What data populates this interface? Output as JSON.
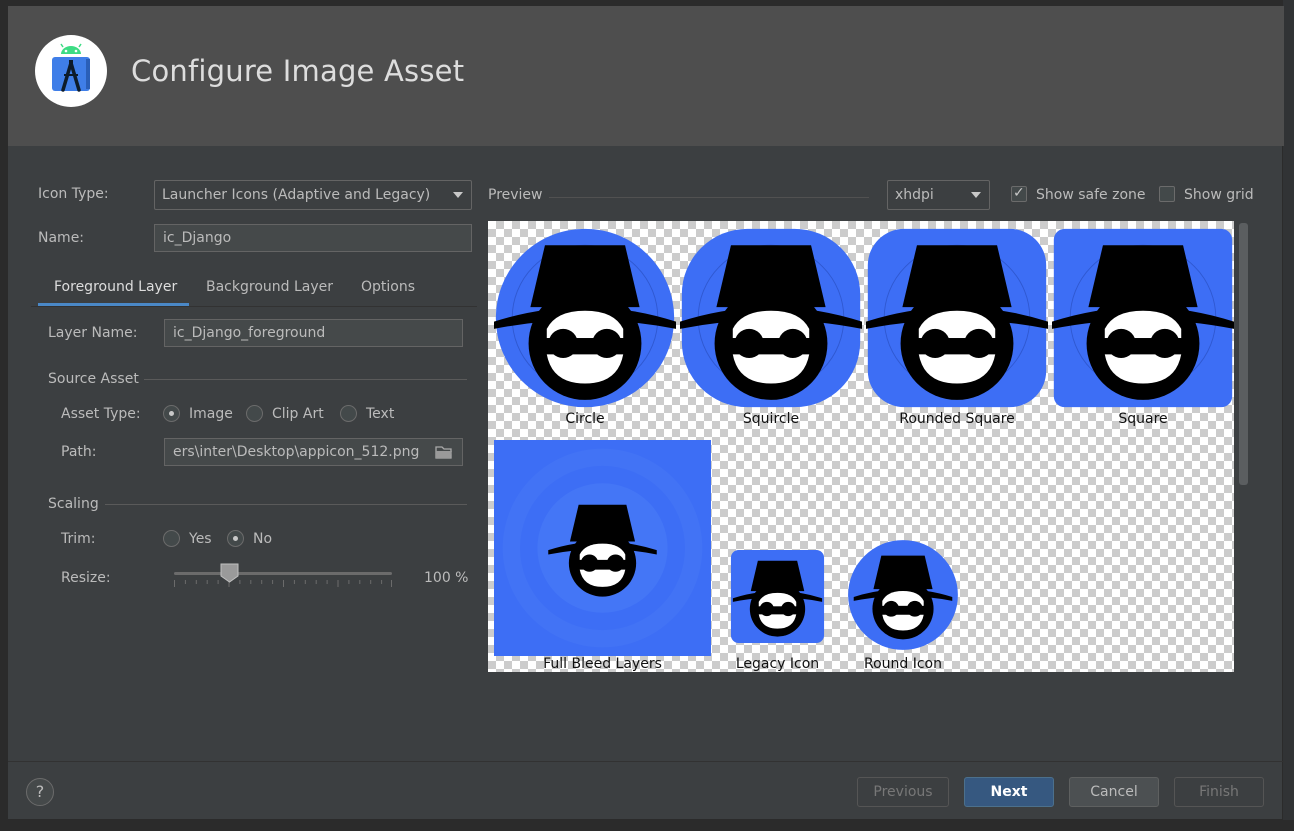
{
  "dialog": {
    "title": "Configure Image Asset",
    "logo_icon": "android-studio-icon"
  },
  "form": {
    "icon_type_label": "Icon Type:",
    "icon_type_value": "Launcher Icons (Adaptive and Legacy)",
    "name_label": "Name:",
    "name_value": "ic_Django"
  },
  "tabs": [
    {
      "label": "Foreground Layer",
      "selected": true
    },
    {
      "label": "Background Layer",
      "selected": false
    },
    {
      "label": "Options",
      "selected": false
    }
  ],
  "foreground": {
    "layer_name_label": "Layer Name:",
    "layer_name_value": "ic_Django_foreground",
    "source_asset_title": "Source Asset",
    "asset_type_label": "Asset Type:",
    "asset_type_options": [
      "Image",
      "Clip Art",
      "Text"
    ],
    "asset_type_selected": "Image",
    "path_label": "Path:",
    "path_value": "ers\\inter\\Desktop\\appicon_512.png",
    "path_browse_icon": "folder-icon",
    "scaling_title": "Scaling",
    "trim_label": "Trim:",
    "trim_options": [
      "Yes",
      "No"
    ],
    "trim_selected": "No",
    "resize_label": "Resize:",
    "resize_value": "100 %",
    "resize_slider_fraction": 0.25
  },
  "preview": {
    "label": "Preview",
    "density_value": "xhdpi",
    "show_safe_zone_label": "Show safe zone",
    "show_safe_zone_checked": true,
    "show_grid_label": "Show grid",
    "show_grid_checked": false,
    "icons": [
      {
        "label": "Circle"
      },
      {
        "label": "Squircle"
      },
      {
        "label": "Rounded Square"
      },
      {
        "label": "Square"
      },
      {
        "label": "Full Bleed Layers"
      },
      {
        "label": "Legacy Icon"
      },
      {
        "label": "Round Icon"
      }
    ],
    "icon_glyph": "spy-face-icon",
    "accent_color": "#3d6ef5"
  },
  "buttons": {
    "help": "?",
    "previous": "Previous",
    "next": "Next",
    "cancel": "Cancel",
    "finish": "Finish"
  }
}
